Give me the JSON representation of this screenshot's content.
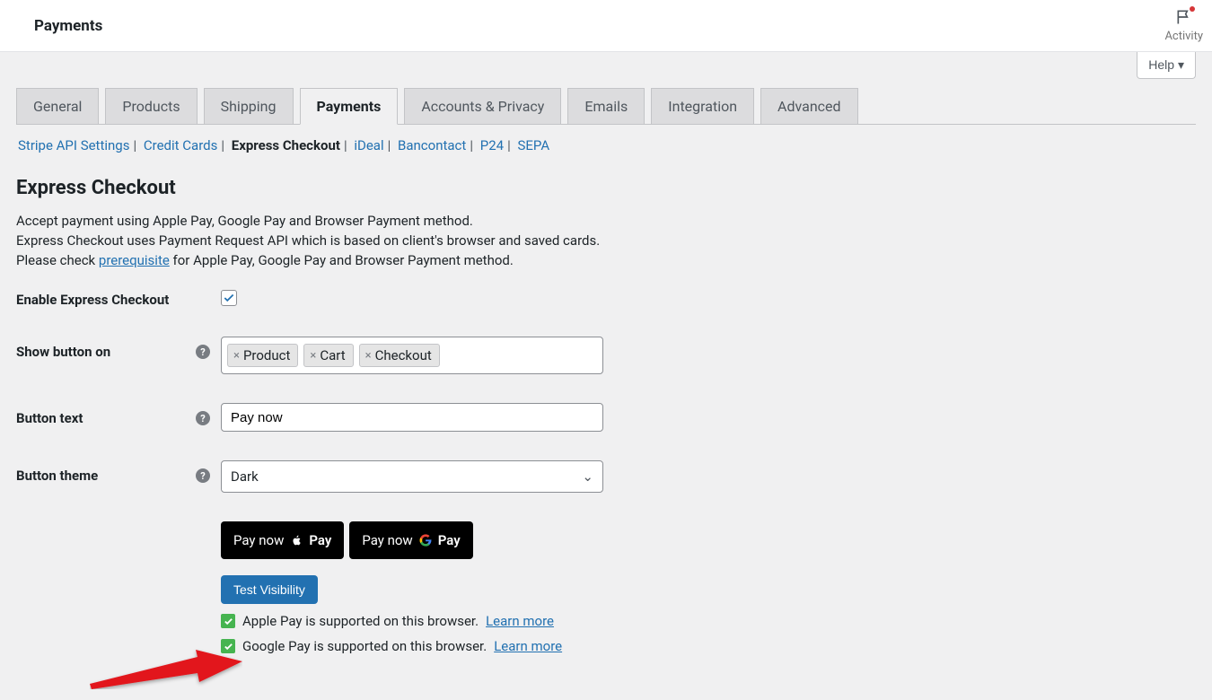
{
  "header": {
    "title": "Payments",
    "activity_label": "Activity"
  },
  "help_button": "Help ▾",
  "tabs": [
    {
      "label": "General",
      "active": false
    },
    {
      "label": "Products",
      "active": false
    },
    {
      "label": "Shipping",
      "active": false
    },
    {
      "label": "Payments",
      "active": true
    },
    {
      "label": "Accounts & Privacy",
      "active": false
    },
    {
      "label": "Emails",
      "active": false
    },
    {
      "label": "Integration",
      "active": false
    },
    {
      "label": "Advanced",
      "active": false
    }
  ],
  "subtabs": [
    {
      "label": "Stripe API Settings",
      "active": false
    },
    {
      "label": "Credit Cards",
      "active": false
    },
    {
      "label": "Express Checkout",
      "active": true
    },
    {
      "label": "iDeal",
      "active": false
    },
    {
      "label": "Bancontact",
      "active": false
    },
    {
      "label": "P24",
      "active": false
    },
    {
      "label": "SEPA",
      "active": false
    }
  ],
  "section": {
    "title": "Express Checkout",
    "desc_line1": "Accept payment using Apple Pay, Google Pay and Browser Payment method.",
    "desc_line2": "Express Checkout uses Payment Request API which is based on client's browser and saved cards.",
    "desc_line3a": "Please check ",
    "desc_prereq": "prerequisite",
    "desc_line3b": " for Apple Pay, Google Pay and Browser Payment method."
  },
  "form": {
    "enable": {
      "label": "Enable Express Checkout",
      "checked": true
    },
    "show_on": {
      "label": "Show button on",
      "tags": [
        "Product",
        "Cart",
        "Checkout"
      ]
    },
    "button_text": {
      "label": "Button text",
      "value": "Pay now"
    },
    "button_theme": {
      "label": "Button theme",
      "value": "Dark"
    }
  },
  "preview": {
    "paynow_apple": "Pay now",
    "paynow_google": "Pay now",
    "apple_brand": "Pay",
    "google_brand": "Pay",
    "test_visibility": "Test Visibility",
    "apple_support": "Apple Pay is supported on this browser.",
    "google_support": "Google Pay is supported on this browser.",
    "learn_more": "Learn more"
  }
}
